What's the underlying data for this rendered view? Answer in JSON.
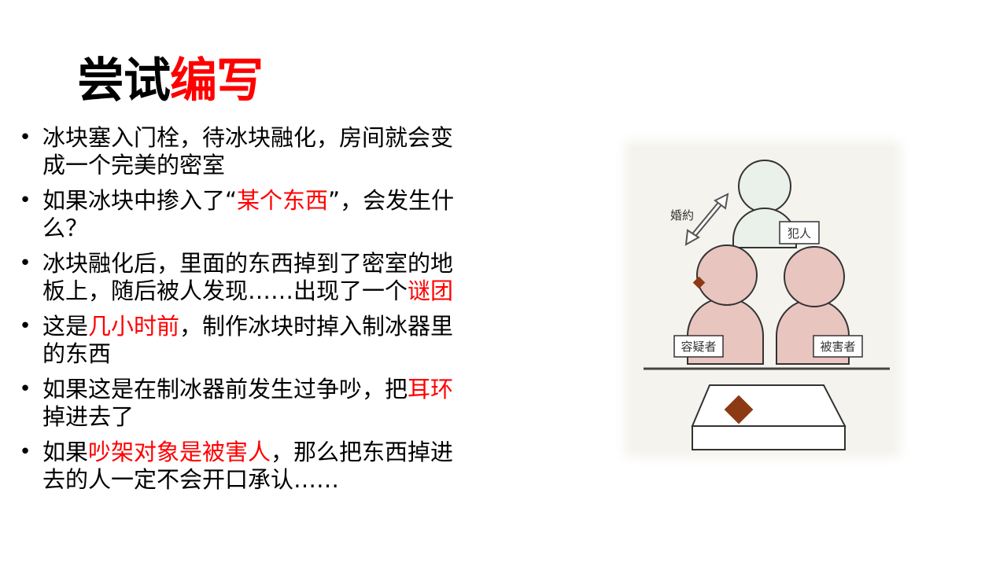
{
  "title": {
    "part1": "尝试",
    "part2": "编写"
  },
  "bullets": [
    {
      "segments": [
        {
          "text": "冰块塞入门栓，待冰块融化，房间就会变成一个完美的密室",
          "highlight": false
        }
      ]
    },
    {
      "segments": [
        {
          "text": "如果冰块中掺入了“",
          "highlight": false
        },
        {
          "text": "某个东西",
          "highlight": true
        },
        {
          "text": "”，会发生什么？",
          "highlight": false
        }
      ]
    },
    {
      "segments": [
        {
          "text": "冰块融化后，里面的东西掉到了密室的地板上，随后被人发现……出现了一个",
          "highlight": false
        },
        {
          "text": "谜团",
          "highlight": true
        }
      ]
    },
    {
      "segments": [
        {
          "text": "这是",
          "highlight": false
        },
        {
          "text": "几小时前",
          "highlight": true
        },
        {
          "text": "，制作冰块时掉入制冰器里的东西",
          "highlight": false
        }
      ]
    },
    {
      "segments": [
        {
          "text": "如果这是在制冰器前发生过争吵，把",
          "highlight": false
        },
        {
          "text": "耳环",
          "highlight": true
        },
        {
          "text": "掉进去了",
          "highlight": false
        }
      ]
    },
    {
      "segments": [
        {
          "text": "如果",
          "highlight": false
        },
        {
          "text": "吵架对象是被害人",
          "highlight": true
        },
        {
          "text": "，那么把东西掉进去的人一定不会开口承认……",
          "highlight": false
        }
      ]
    }
  ],
  "figure": {
    "label_engagement": "婚約",
    "label_culprit": "犯人",
    "label_suspect": "容疑者",
    "label_victim": "被害者"
  },
  "colors": {
    "accent": "#ff0000",
    "figure_bg": "#f4f3ee",
    "person_pink": "#e9c5bf",
    "person_pale": "#eaf0ea",
    "earring": "#8b3a14"
  }
}
